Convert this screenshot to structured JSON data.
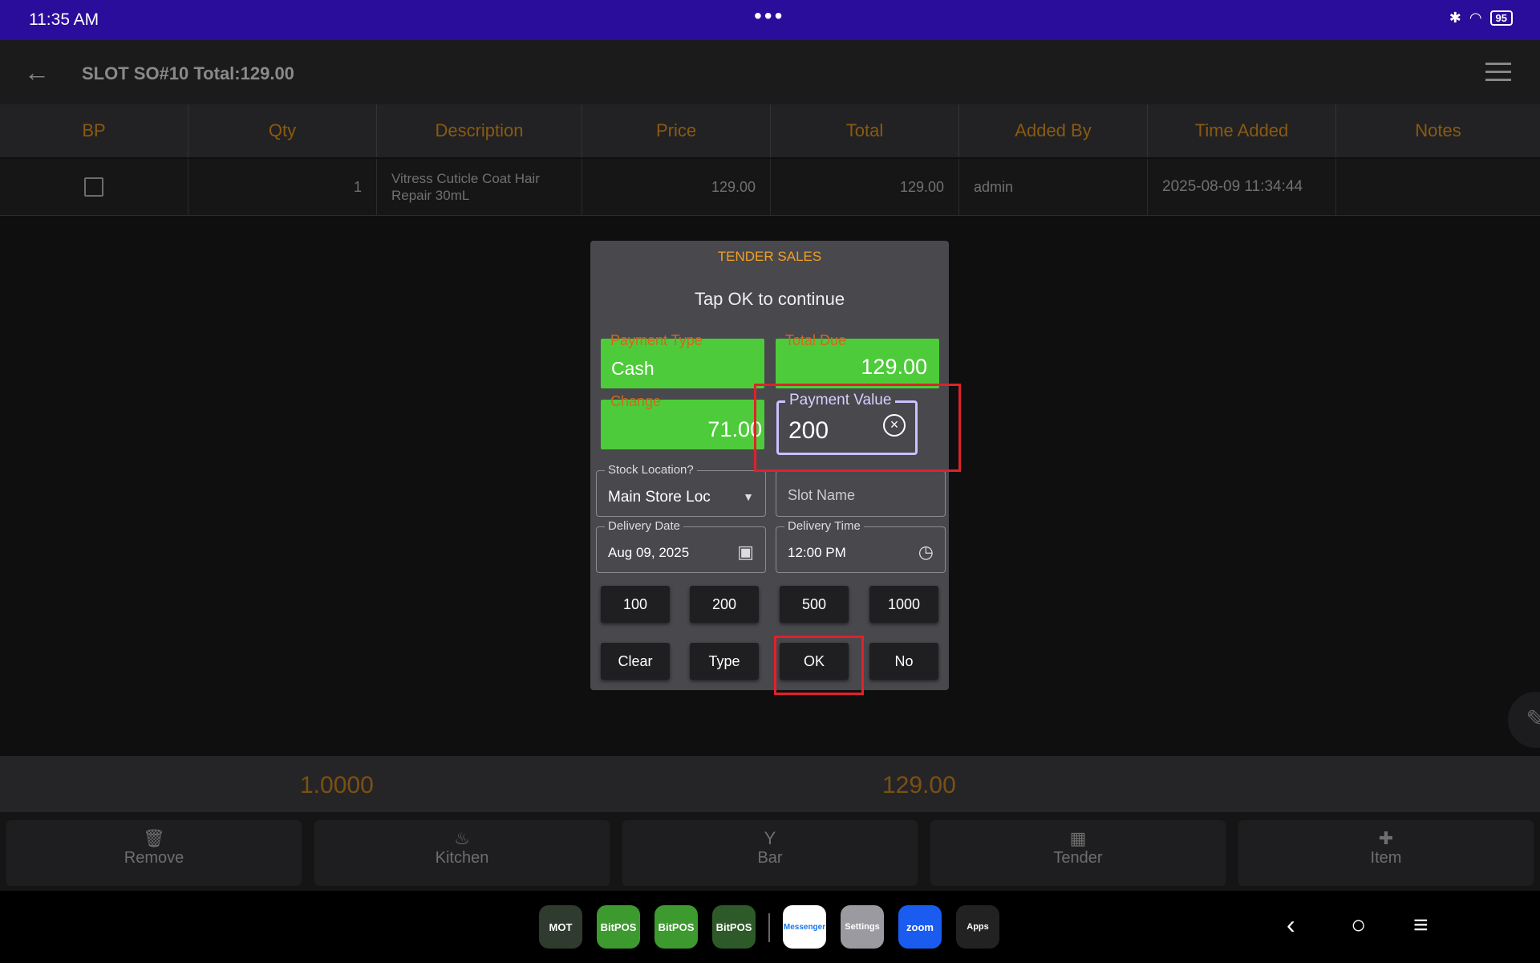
{
  "status_bar": {
    "time": "11:35 AM",
    "dots": "•••",
    "battery": "95"
  },
  "app_bar": {
    "title": "SLOT SO#10 Total:129.00"
  },
  "table": {
    "headers": [
      "BP",
      "Qty",
      "Description",
      "Price",
      "Total",
      "Added By",
      "Time Added",
      "Notes"
    ],
    "rows": [
      {
        "qty": "1",
        "description": "Vitress Cuticle Coat Hair Repair 30mL",
        "price": "129.00",
        "total": "129.00",
        "added_by": "admin",
        "time_added": "2025-08-09 11:34:44",
        "notes": ""
      }
    ]
  },
  "totals": {
    "qty": "1.0000",
    "amount": "129.00"
  },
  "dialog": {
    "title": "TENDER SALES",
    "message": "Tap OK to continue",
    "payment_type": {
      "label": "Payment Type",
      "value": "Cash"
    },
    "total_due": {
      "label": "Total Due",
      "value": "129.00"
    },
    "change": {
      "label": "Change",
      "value": "71.00"
    },
    "payment_value": {
      "label": "Payment Value",
      "value": "200"
    },
    "stock_location": {
      "label": "Stock Location?",
      "value": "Main Store Loc"
    },
    "slot_name": {
      "placeholder": "Slot Name"
    },
    "delivery_date": {
      "label": "Delivery Date",
      "value": "Aug 09, 2025"
    },
    "delivery_time": {
      "label": "Delivery Time",
      "value": "12:00 PM"
    },
    "quick_amounts": [
      "100",
      "200",
      "500",
      "1000"
    ],
    "actions": {
      "clear": "Clear",
      "type": "Type",
      "ok": "OK",
      "no": "No"
    }
  },
  "bottom_actions": [
    {
      "label": "Remove",
      "icon": "trash-icon"
    },
    {
      "label": "Kitchen",
      "icon": "kitchen-icon"
    },
    {
      "label": "Bar",
      "icon": "cocktail-icon"
    },
    {
      "label": "Tender",
      "icon": "calculator-icon"
    },
    {
      "label": "Item",
      "icon": "plus-icon"
    }
  ],
  "dock": [
    "MOT",
    "BitPOS",
    "BitPOS",
    "BitPOS",
    "Messenger",
    "Settings",
    "zoom",
    "Apps"
  ],
  "colors": {
    "accent": "#2a0d9a",
    "green": "#4ecb3a",
    "header_text": "#8a5a10",
    "highlight": "#e0212a",
    "dialog_title": "#f0a020"
  }
}
